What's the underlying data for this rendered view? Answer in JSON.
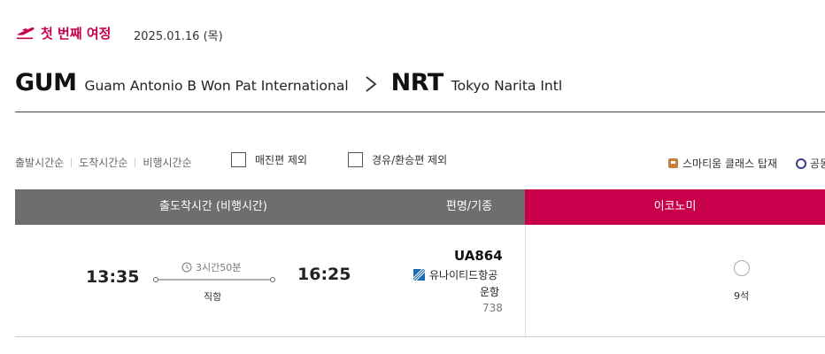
{
  "journey": {
    "title": "첫 번째 여정",
    "date": "2025.01.16 (목)",
    "icon": "plane-takeoff-icon"
  },
  "route": {
    "origin_code": "GUM",
    "origin_name": "Guam Antonio B Won Pat International",
    "destination_code": "NRT",
    "destination_name": "Tokyo Narita Intl"
  },
  "sort_options": [
    "출발시간순",
    "도착시간순",
    "비행시간순"
  ],
  "filters": {
    "exclude_sold_out": {
      "label": "매진편 제외",
      "checked": false
    },
    "exclude_connecting": {
      "label": "경유/환승편 제외",
      "checked": false
    }
  },
  "legend": {
    "smartium": "스마티움 클래스 탑재",
    "codeshare": "공동"
  },
  "table": {
    "headers": {
      "time": "출도착시간 (비행시간)",
      "flight": "편명/기종",
      "cabin": "이코노미"
    },
    "rows": [
      {
        "departure": "13:35",
        "arrival": "16:25",
        "duration": "3시간50분",
        "stops": "직항",
        "flight_no": "UA864",
        "airline": "유나이티드항공",
        "operated": "운항",
        "aircraft": "738",
        "economy_seats": "9석",
        "economy_selected": false
      }
    ]
  },
  "colors": {
    "brand": "#c8004b",
    "header_gray": "#6d6e70",
    "ua_blue": "#1a6ab5"
  }
}
